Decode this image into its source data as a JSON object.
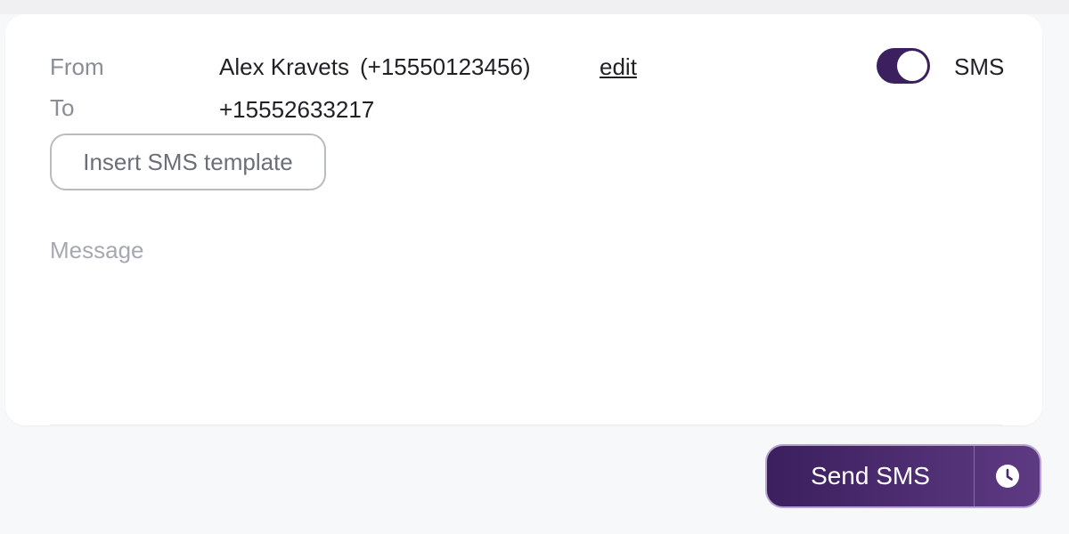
{
  "composer": {
    "from_label": "From",
    "from_name": "Alex Kravets",
    "from_number": "(+15550123456)",
    "edit_label": "edit",
    "to_label": "To",
    "to_value": "+15552633217",
    "channel_toggle": {
      "label": "SMS",
      "on": true
    },
    "template_button_label": "Insert SMS template",
    "message_placeholder": "Message",
    "message_value": ""
  },
  "actions": {
    "send_label": "Send SMS",
    "schedule_icon": "clock-icon"
  },
  "colors": {
    "accent": "#3b1f5e",
    "accent_light": "#5e3a82",
    "text_primary": "#1f2127",
    "text_secondary": "#8a8d96"
  }
}
